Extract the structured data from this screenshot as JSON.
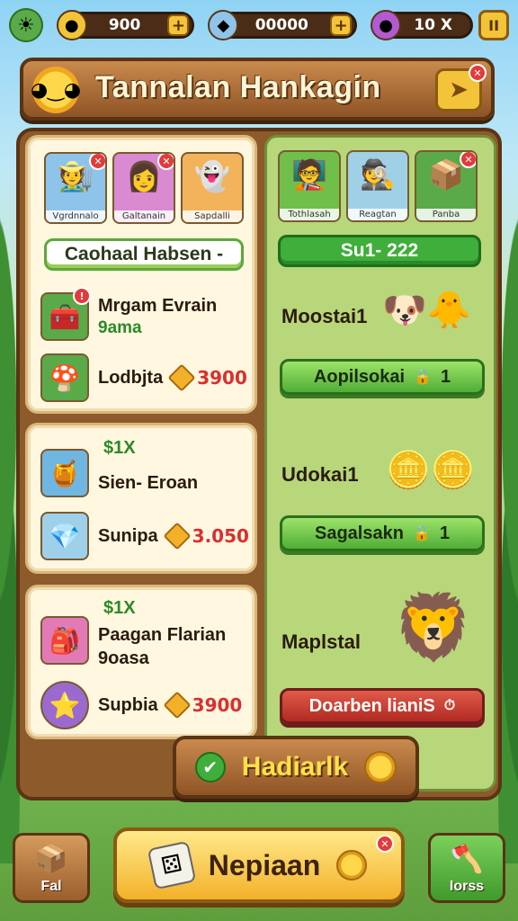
{
  "topbar": {
    "gold": "900",
    "gems": "00000",
    "berries": "10 X",
    "pause_glyph": "II"
  },
  "title": {
    "text": "Tannalan Hankagin",
    "close_glyph": "➤"
  },
  "left_panel": {
    "portraits": [
      {
        "name": "Vgrdnnalo",
        "face": "🧑‍🌾"
      },
      {
        "name": "Galtanain",
        "face": "👩"
      },
      {
        "name": "Sapdalli",
        "face": "👻"
      }
    ],
    "section_label": "Caohaal Habsen -",
    "card1_items": [
      {
        "title": "Mrgam Evrain",
        "sub": "9ama",
        "icon": "🧰"
      },
      {
        "title": "Lodbjta",
        "price": "3900",
        "icon": "🍄"
      }
    ],
    "card2_tag": "$1X",
    "card2_items": [
      {
        "title": "Sien- Eroan",
        "icon": "🍯"
      },
      {
        "title": "Sunipa",
        "price": "3.050",
        "icon": "💎"
      }
    ],
    "card3_tag": "$1X",
    "card3_items": [
      {
        "title": "Paagan Flarian",
        "sub": "9oasa",
        "icon": "🎒"
      },
      {
        "title": "Supbia",
        "price": "3900",
        "icon": "⭐"
      }
    ]
  },
  "right_panel": {
    "portraits": [
      {
        "name": "Tothlasah",
        "face": "🧑‍🏫"
      },
      {
        "name": "Reagtan",
        "face": "🕵️"
      },
      {
        "name": "Panba",
        "face": "📦"
      }
    ],
    "section_label": "Su1- 222",
    "rows": [
      {
        "label": "Moostai1",
        "art": "🐶🐥",
        "button": "Aopilsokai",
        "count": "1"
      },
      {
        "label": "Udokai1",
        "art": "🪙🪙",
        "button": "Sagalsakn",
        "count": "1"
      },
      {
        "label": "Maplstal",
        "art": "🦁",
        "button": "Doarben lianiS",
        "count": ""
      }
    ]
  },
  "claim": {
    "label": "Hadiarlk"
  },
  "bottom": {
    "left_label": "Fal",
    "main_label": "Nepiaan",
    "right_label": "Iorss"
  },
  "colors": {
    "wood": "#8d5a2b",
    "panel_green": "#b7d77a",
    "button_green": "#4fae36",
    "button_red": "#b12a22",
    "gold": "#f3c33a"
  }
}
